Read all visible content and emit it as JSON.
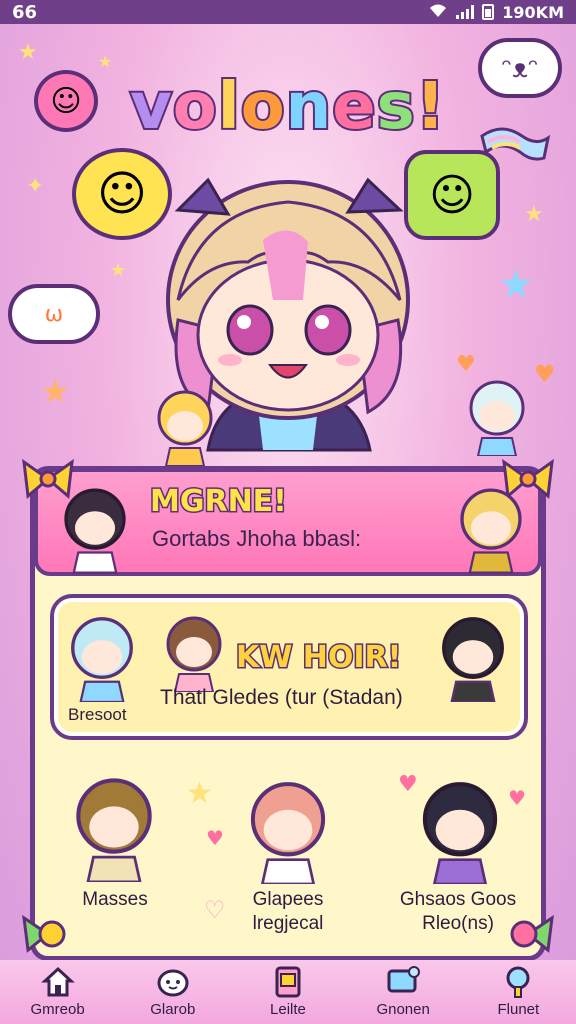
{
  "status": {
    "left": "66",
    "time": "190KM"
  },
  "app": {
    "title_letters": [
      "v",
      "o",
      "l",
      "o",
      "n",
      "e",
      "s",
      "!"
    ]
  },
  "banner": {
    "title": "MGRNE!",
    "subtitle": "Gortabs Jhoha bbasl:"
  },
  "featured": {
    "title": "KW HOIR!",
    "subtitle": "Thatl Gledes (tur (Stadan)",
    "left_label": "Bresoot"
  },
  "characters": [
    {
      "label": "Masses"
    },
    {
      "label": "Glapees\nlregjecal"
    },
    {
      "label": "Ghsaos Goos\nRleo(ns)"
    }
  ],
  "nav": [
    {
      "label": "Gmreob",
      "icon": "home-icon"
    },
    {
      "label": "Glarob",
      "icon": "cloud-face-icon"
    },
    {
      "label": "Leilte",
      "icon": "card-icon"
    },
    {
      "label": "Gnonen",
      "icon": "screen-icon"
    },
    {
      "label": "Flunet",
      "icon": "search-icon"
    }
  ],
  "colors": {
    "status_bar": "#6f3f8a",
    "banner": "#ff77b8",
    "card": "#fff6c9",
    "outline": "#6a3b8a"
  }
}
